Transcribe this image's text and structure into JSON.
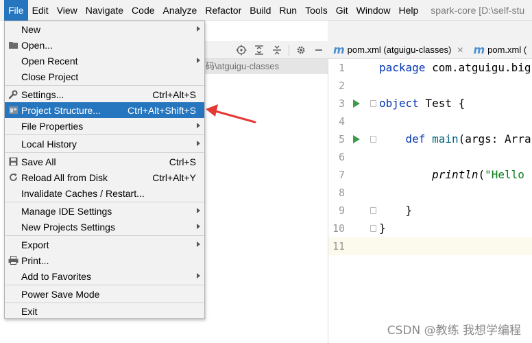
{
  "menubar": {
    "items": [
      "File",
      "Edit",
      "View",
      "Navigate",
      "Code",
      "Analyze",
      "Refactor",
      "Build",
      "Run",
      "Tools",
      "Git",
      "Window",
      "Help"
    ],
    "project_title": "spark-core [D:\\self-stu"
  },
  "file_menu": {
    "items": [
      {
        "label": "New",
        "shortcut": "",
        "submenu": true,
        "icon": ""
      },
      {
        "label": "Open...",
        "shortcut": "",
        "submenu": false,
        "icon": "folder-icon"
      },
      {
        "label": "Open Recent",
        "shortcut": "",
        "submenu": true,
        "icon": ""
      },
      {
        "label": "Close Project",
        "shortcut": "",
        "submenu": false,
        "icon": ""
      },
      {
        "label": "Settings...",
        "shortcut": "Ctrl+Alt+S",
        "submenu": false,
        "icon": "wrench-icon"
      },
      {
        "label": "Project Structure...",
        "shortcut": "Ctrl+Alt+Shift+S",
        "submenu": false,
        "icon": "project-structure-icon",
        "selected": true
      },
      {
        "label": "File Properties",
        "shortcut": "",
        "submenu": true,
        "icon": ""
      },
      {
        "label": "Local History",
        "shortcut": "",
        "submenu": true,
        "icon": ""
      },
      {
        "label": "Save All",
        "shortcut": "Ctrl+S",
        "submenu": false,
        "icon": "save-icon"
      },
      {
        "label": "Reload All from Disk",
        "shortcut": "Ctrl+Alt+Y",
        "submenu": false,
        "icon": "reload-icon"
      },
      {
        "label": "Invalidate Caches / Restart...",
        "shortcut": "",
        "submenu": false,
        "icon": ""
      },
      {
        "label": "Manage IDE Settings",
        "shortcut": "",
        "submenu": true,
        "icon": ""
      },
      {
        "label": "New Projects Settings",
        "shortcut": "",
        "submenu": true,
        "icon": ""
      },
      {
        "label": "Export",
        "shortcut": "",
        "submenu": true,
        "icon": ""
      },
      {
        "label": "Print...",
        "shortcut": "",
        "submenu": false,
        "icon": "print-icon"
      },
      {
        "label": "Add to Favorites",
        "shortcut": "",
        "submenu": true,
        "icon": ""
      },
      {
        "label": "Power Save Mode",
        "shortcut": "",
        "submenu": false,
        "icon": ""
      },
      {
        "label": "Exit",
        "shortcut": "",
        "submenu": false,
        "icon": ""
      }
    ]
  },
  "project_panel": {
    "path_text": "码\\atguigu-classes"
  },
  "editor": {
    "tabs": [
      {
        "label": "pom.xml (atguigu-classes)",
        "closable": true
      },
      {
        "label": "pom.xml (",
        "closable": false
      }
    ],
    "line_numbers": [
      "1",
      "2",
      "3",
      "4",
      "5",
      "6",
      "7",
      "8",
      "9",
      "10",
      "11"
    ],
    "code": {
      "l1_kw": "package",
      "l1_rest": " com.atguigu.big",
      "l3_kw": "object",
      "l3_rest": " Test {",
      "l5_kw": "def",
      "l5_fn": "main",
      "l5_rest": "(args: Arra",
      "l7_fn": "println",
      "l7_paren": "(",
      "l7_str": "\"Hello",
      "l9": "}",
      "l10": "}"
    }
  },
  "watermark": "CSDN @教练 我想学编程",
  "colors": {
    "accent": "#2675bf",
    "annotation_arrow": "#e53935"
  }
}
